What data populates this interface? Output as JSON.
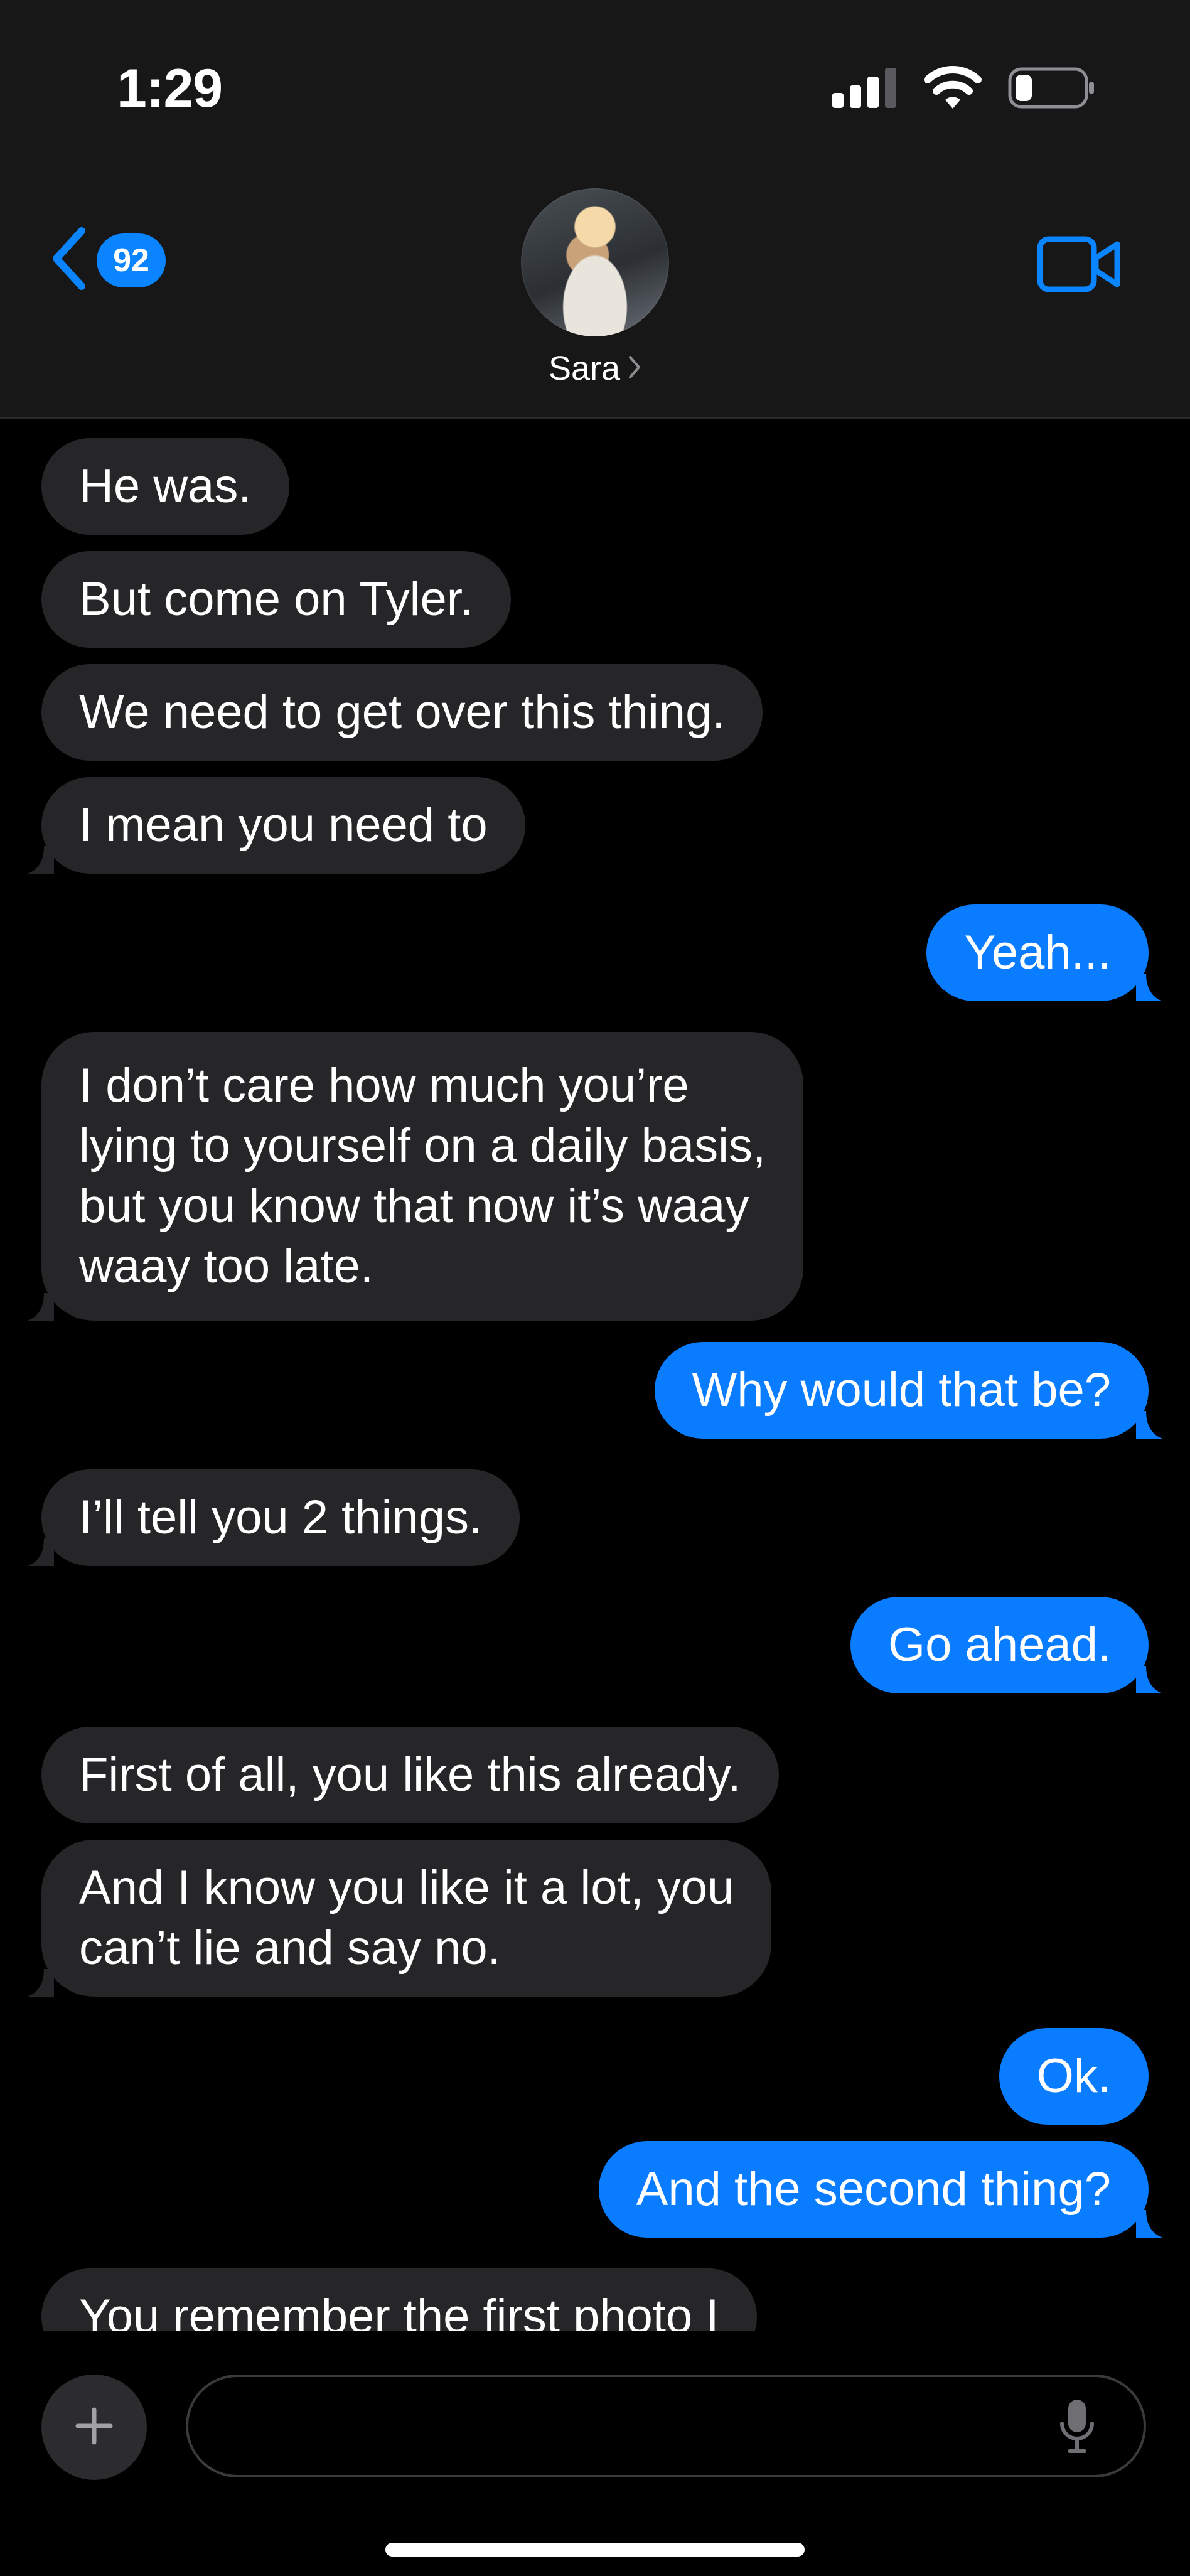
{
  "status_bar": {
    "time": "1:29"
  },
  "header": {
    "unread_count": "92",
    "contact_name": "Sara",
    "accent_color": "#0a84ff"
  },
  "messages": [
    {
      "from": "them",
      "text": "He was."
    },
    {
      "from": "them",
      "text": "But come on Tyler."
    },
    {
      "from": "them",
      "text": "We need to get over this thing."
    },
    {
      "from": "them",
      "text": "I mean you need to"
    },
    {
      "from": "me",
      "text": "Yeah..."
    },
    {
      "from": "them",
      "lines": [
        "I don’t care how much you’re",
        "lying to yourself on a daily basis,",
        "but you know that now it’s waay",
        "waay too late."
      ]
    },
    {
      "from": "me",
      "text": "Why would that be?"
    },
    {
      "from": "them",
      "text": "I’ll tell you 2 things."
    },
    {
      "from": "me",
      "text": "Go ahead."
    },
    {
      "from": "them",
      "text": "First of all, you like this already."
    },
    {
      "from": "them",
      "lines": [
        "And I know you like it a lot, you",
        "can’t lie and say no."
      ]
    },
    {
      "from": "me",
      "text": "Ok."
    },
    {
      "from": "me",
      "text": "And the second thing?"
    },
    {
      "from": "them",
      "text": "You remember the first photo I"
    }
  ],
  "composer": {
    "input_value": "",
    "input_placeholder": ""
  },
  "colors": {
    "incoming_bubble": "#262628",
    "outgoing_bubble": "#0a7cff",
    "background": "#000000",
    "header_background": "#171717"
  },
  "icons": {
    "back": "chevron-left-icon",
    "video": "video-camera-icon",
    "plus": "plus-icon",
    "mic": "microphone-icon",
    "signal": "cellular-signal-icon",
    "wifi": "wifi-icon",
    "battery": "battery-icon"
  }
}
